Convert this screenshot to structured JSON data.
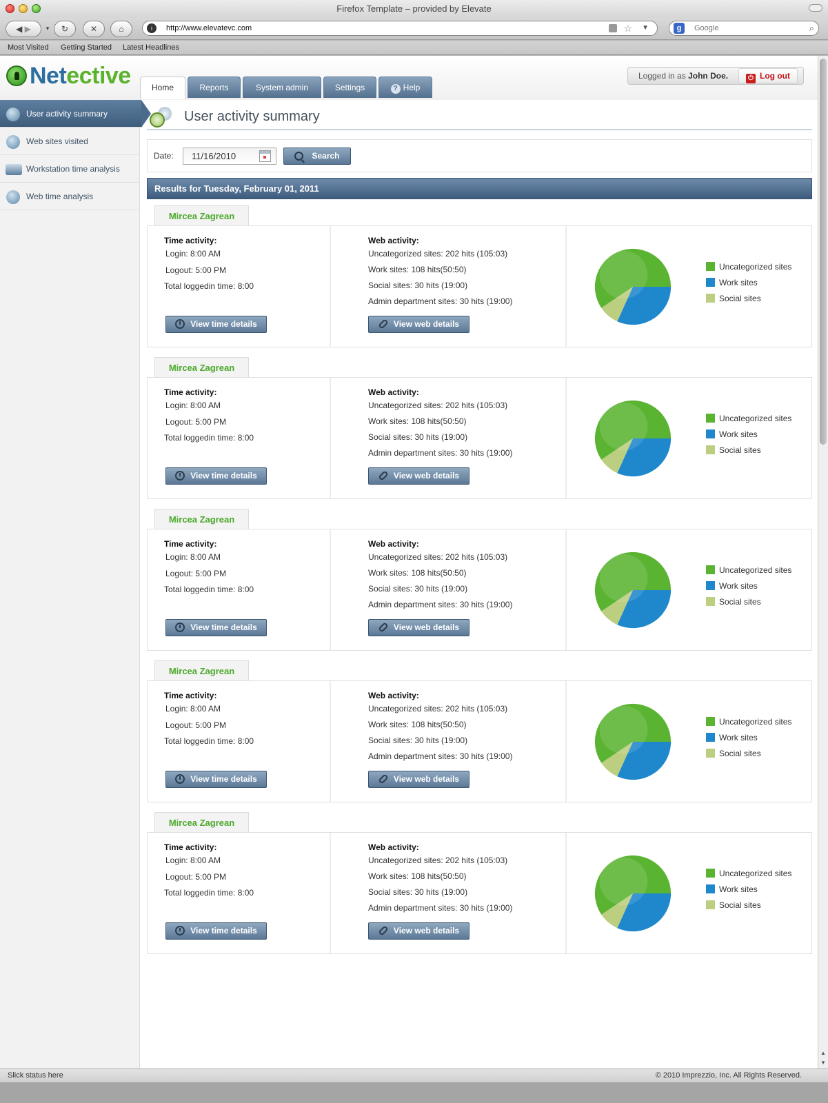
{
  "browser": {
    "window_title": "Firefox Template – provided by Elevate",
    "url": "http://www.elevatevc.com",
    "search_placeholder": "Google",
    "bookmarks": [
      "Most Visited",
      "Getting Started",
      "Latest Headlines"
    ]
  },
  "app": {
    "logo_part1": "Net",
    "logo_part2": "ective",
    "tabs": [
      {
        "label": "Home",
        "active": true
      },
      {
        "label": "Reports",
        "active": false
      },
      {
        "label": "System admin",
        "active": false
      },
      {
        "label": "Settings",
        "active": false
      },
      {
        "label": "Help",
        "active": false,
        "icon": "help-icon"
      }
    ],
    "login_prefix": "Logged in as",
    "login_user": "John Doe.",
    "logout_label": "Log out"
  },
  "sidebar": {
    "items": [
      {
        "label": "User activity summary",
        "active": true,
        "icon": "users-icon"
      },
      {
        "label": "Web sites visited",
        "active": false,
        "icon": "globe-icon"
      },
      {
        "label": "Workstation time analysis",
        "active": false,
        "icon": "monitor-icon"
      },
      {
        "label": "Web time analysis",
        "active": false,
        "icon": "globe-clock-icon"
      }
    ]
  },
  "main": {
    "title": "User activity summary",
    "date_label": "Date:",
    "date_value": "11/16/2010",
    "search_label": "Search",
    "results_title": "Results for Tuesday, February 01, 2011"
  },
  "colors": {
    "uncategorized": "#5ab432",
    "work": "#1f88cc",
    "social": "#bccf80",
    "accent_green": "#4ba92a",
    "nav_blue": "#53708f"
  },
  "records": [
    {
      "name": "Mircea Zagrean",
      "time_title": "Time activity:",
      "login": "Login:  8:00 AM",
      "logout": "Logout:  5:00 PM",
      "total": "Total loggedin time: 8:00",
      "time_button": "View time details",
      "web_title": "Web activity:",
      "web_lines": [
        "Uncategorized sites:  202 hits (105:03)",
        "Work sites:  108 hits(50:50)",
        "Social sites: 30 hits (19:00)",
        "Admin department sites: 30 hits (19:00)"
      ],
      "web_button": "View web details",
      "legend": [
        "Uncategorized sites",
        "Work sites",
        "Social sites"
      ]
    },
    {
      "name": "Mircea Zagrean",
      "time_title": "Time activity:",
      "login": "Login:  8:00 AM",
      "logout": "Logout:  5:00 PM",
      "total": "Total loggedin time: 8:00",
      "time_button": "View time details",
      "web_title": "Web activity:",
      "web_lines": [
        "Uncategorized sites:  202 hits (105:03)",
        "Work sites:  108 hits(50:50)",
        "Social sites: 30 hits (19:00)",
        "Admin department sites: 30 hits (19:00)"
      ],
      "web_button": "View web details",
      "legend": [
        "Uncategorized sites",
        "Work sites",
        "Social sites"
      ]
    },
    {
      "name": "Mircea Zagrean",
      "time_title": "Time activity:",
      "login": "Login:  8:00 AM",
      "logout": "Logout:  5:00 PM",
      "total": "Total loggedin time: 8:00",
      "time_button": "View time details",
      "web_title": "Web activity:",
      "web_lines": [
        "Uncategorized sites:  202 hits (105:03)",
        "Work sites:  108 hits(50:50)",
        "Social sites: 30 hits (19:00)",
        "Admin department sites: 30 hits (19:00)"
      ],
      "web_button": "View web details",
      "legend": [
        "Uncategorized sites",
        "Work sites",
        "Social sites"
      ]
    },
    {
      "name": "Mircea Zagrean",
      "time_title": "Time activity:",
      "login": "Login:  8:00 AM",
      "logout": "Logout:  5:00 PM",
      "total": "Total loggedin time: 8:00",
      "time_button": "View time details",
      "web_title": "Web activity:",
      "web_lines": [
        "Uncategorized sites:  202 hits (105:03)",
        "Work sites:  108 hits(50:50)",
        "Social sites: 30 hits (19:00)",
        "Admin department sites: 30 hits (19:00)"
      ],
      "web_button": "View web details",
      "legend": [
        "Uncategorized sites",
        "Work sites",
        "Social sites"
      ]
    },
    {
      "name": "Mircea Zagrean",
      "time_title": "Time activity:",
      "login": "Login:  8:00 AM",
      "logout": "Logout:  5:00 PM",
      "total": "Total loggedin time: 8:00",
      "time_button": "View time details",
      "web_title": "Web activity:",
      "web_lines": [
        "Uncategorized sites:  202 hits (105:03)",
        "Work sites:  108 hits(50:50)",
        "Social sites: 30 hits (19:00)",
        "Admin department sites: 30 hits (19:00)"
      ],
      "web_button": "View web details",
      "legend": [
        "Uncategorized sites",
        "Work sites",
        "Social sites"
      ]
    }
  ],
  "chart_data": {
    "type": "pie",
    "labels": [
      "Uncategorized sites",
      "Work sites",
      "Social sites"
    ],
    "values": [
      202,
      108,
      30
    ]
  },
  "status": {
    "left": "Slick status here",
    "right": "© 2010 Imprezzio, Inc. All Rights Reserved."
  }
}
